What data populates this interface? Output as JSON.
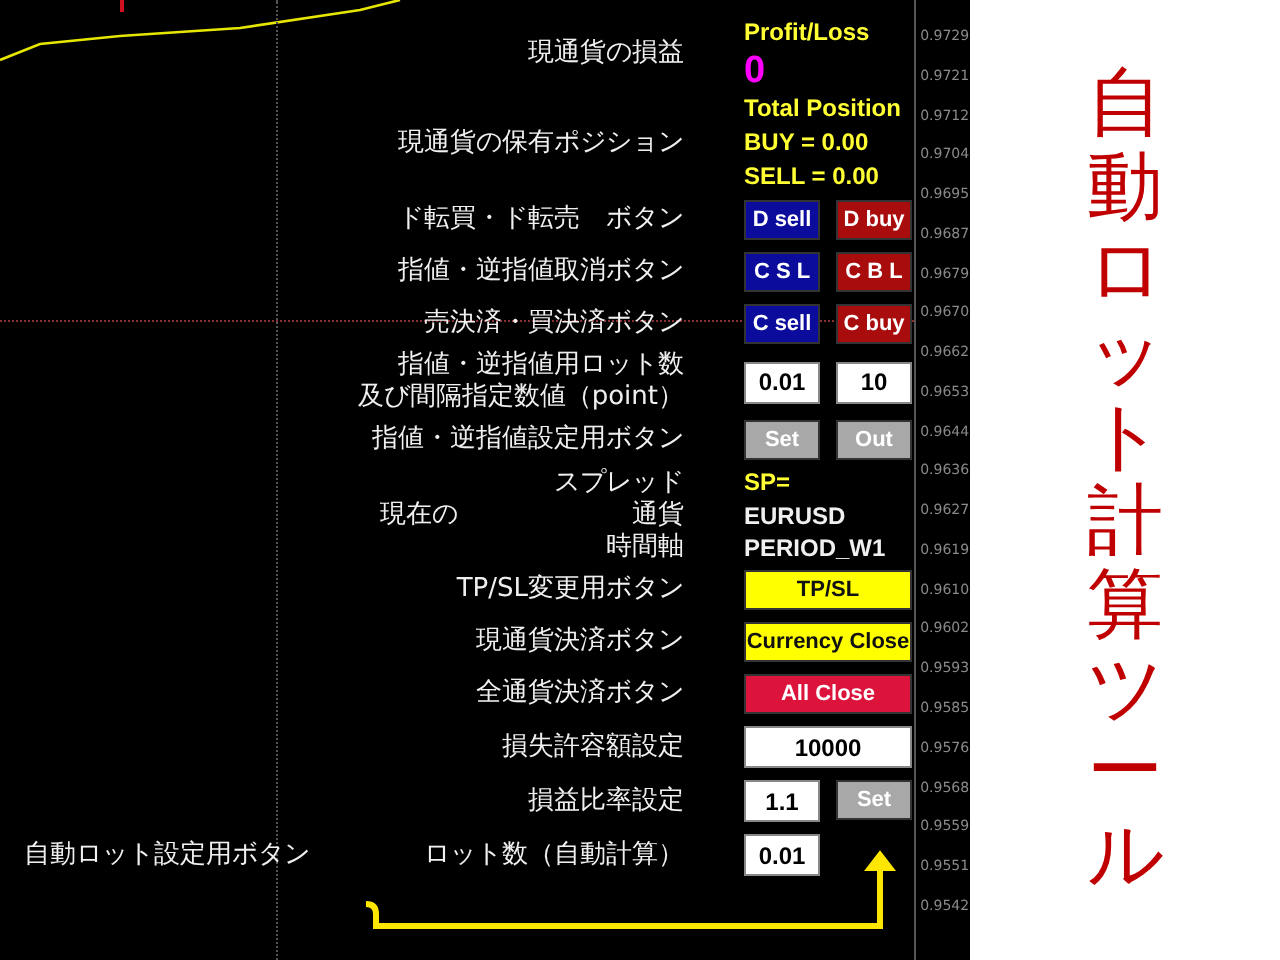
{
  "side_title": "自動ロット計算ツール",
  "price_axis": [
    "0.9729",
    "0.9721",
    "0.9712",
    "0.9704",
    "0.9695",
    "0.9687",
    "0.9679",
    "0.9670",
    "0.9662",
    "0.9653",
    "0.9644",
    "0.9636",
    "0.9627",
    "0.9619",
    "0.9610",
    "0.9602",
    "0.9593",
    "0.9585",
    "0.9576",
    "0.9568",
    "0.9559",
    "0.9551",
    "0.9542"
  ],
  "panel": {
    "rows": [
      {
        "kind": "info",
        "label": "現通貨の損益",
        "lines": [
          {
            "text": "Profit/Loss",
            "kind": "heading"
          },
          {
            "text": "0",
            "kind": "value"
          }
        ]
      },
      {
        "kind": "info",
        "label": "現通貨の保有ポジション",
        "lines": [
          {
            "text": "Total Position",
            "kind": "heading"
          },
          {
            "text": "BUY = 0.00",
            "kind": "heading"
          },
          {
            "text": "SELL = 0.00",
            "kind": "heading"
          }
        ]
      },
      {
        "kind": "controls",
        "label": "ド転買・ド転売　ボタン",
        "controls": [
          {
            "kind": "button",
            "text": "D sell",
            "color": "#0c0c9c",
            "wide": false
          },
          {
            "kind": "button",
            "text": "D buy",
            "color": "#a80c0c",
            "wide": false
          }
        ]
      },
      {
        "kind": "controls",
        "label": "指値・逆指値取消ボタン",
        "controls": [
          {
            "kind": "button",
            "text": "C S L",
            "color": "#0c0c9c",
            "wide": false
          },
          {
            "kind": "button",
            "text": "C B L",
            "color": "#a80c0c",
            "wide": false
          }
        ]
      },
      {
        "kind": "controls",
        "label": "売決済・買決済ボタン",
        "controls": [
          {
            "kind": "button",
            "text": "C sell",
            "color": "#0c0c9c",
            "wide": false
          },
          {
            "kind": "button",
            "text": "C buy",
            "color": "#a80c0c",
            "wide": false
          }
        ]
      },
      {
        "kind": "controls",
        "label": "指値・逆指値用ロット数",
        "label_2": "及び間隔指定数値（point）",
        "controls": [
          {
            "kind": "field",
            "value": "0.01",
            "wide": false
          },
          {
            "kind": "field",
            "value": "10",
            "wide": false
          }
        ]
      },
      {
        "kind": "controls",
        "label": "指値・逆指値設定用ボタン",
        "controls": [
          {
            "kind": "button",
            "text": "Set",
            "color": "#a8a8a8",
            "wide": false
          },
          {
            "kind": "button",
            "text": "Out",
            "color": "#a8a8a8",
            "wide": false
          }
        ]
      },
      {
        "kind": "market",
        "prefix": "現在の",
        "labels": [
          "スプレッド",
          "通貨",
          "時間軸"
        ],
        "lines": [
          {
            "text": "SP=",
            "kind": "heading"
          },
          {
            "text": "EURUSD",
            "kind": "plain"
          },
          {
            "text": "PERIOD_W1",
            "kind": "plain"
          }
        ]
      },
      {
        "kind": "controls",
        "label": "TP/SL変更用ボタン",
        "controls": [
          {
            "kind": "button",
            "text": "TP/SL",
            "color": "#ffff00",
            "wide": true
          }
        ]
      },
      {
        "kind": "controls",
        "label": "現通貨決済ボタン",
        "controls": [
          {
            "kind": "button",
            "text": "Currency Close",
            "color": "#ffff00",
            "wide": true
          }
        ]
      },
      {
        "kind": "controls",
        "label": "全通貨決済ボタン",
        "controls": [
          {
            "kind": "button",
            "text": "All Close",
            "color": "#dc143c",
            "wide": true
          }
        ]
      },
      {
        "kind": "controls",
        "label": "損失許容額設定",
        "controls": [
          {
            "kind": "field",
            "value": "10000",
            "wide": true
          }
        ]
      },
      {
        "kind": "controls",
        "label": "損益比率設定",
        "controls": [
          {
            "kind": "field",
            "value": "1.1",
            "wide": false
          },
          {
            "kind": "button",
            "text": "Set",
            "color": "#a8a8a8",
            "wide": false
          }
        ]
      },
      {
        "kind": "controls",
        "note": "自動ロット設定用ボタン",
        "label": "ロット数（自動計算）",
        "controls": [
          {
            "kind": "field",
            "value": "0.01",
            "wide": false
          }
        ]
      }
    ]
  }
}
